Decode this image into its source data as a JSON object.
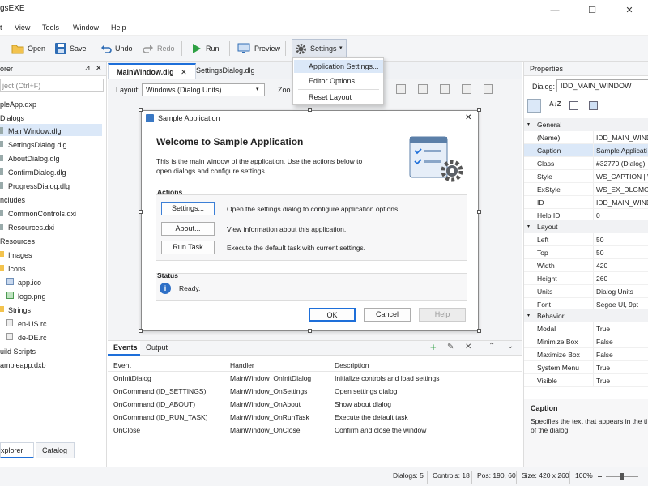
{
  "window": {
    "title": "gsEXE"
  },
  "menu": [
    "t",
    "View",
    "Tools",
    "Window",
    "Help"
  ],
  "toolbar": {
    "open": "Open",
    "save": "Save",
    "undo": "Undo",
    "redo": "Redo",
    "run": "Run",
    "preview": "Preview",
    "settings": "Settings"
  },
  "settings_menu": [
    "Application Settings...",
    "Editor Options...",
    "Reset Layout"
  ],
  "explorer": {
    "title": "orer",
    "search_placeholder": "ject (Ctrl+F)",
    "items": [
      "pleApp.dxp",
      "Dialogs",
      "MainWindow.dlg",
      "SettingsDialog.dlg",
      "AboutDialog.dlg",
      "ConfirmDialog.dlg",
      "ProgressDialog.dlg",
      "ncludes",
      "CommonControls.dxi",
      "Resources.dxi",
      "Resources",
      "Images",
      "Icons",
      "app.ico",
      "logo.png",
      "Strings",
      "en-US.rc",
      "de-DE.rc",
      "uild Scripts",
      "ampleapp.dxb"
    ],
    "bottom_tabs": [
      "xplorer",
      "Catalog"
    ]
  },
  "doc_tabs": [
    "MainWindow.dlg",
    "SettingsDialog.dlg"
  ],
  "designer": {
    "layout_label": "Layout:",
    "layout_value": "Windows (Dialog Units)",
    "zoom_label": "Zoo"
  },
  "dialog": {
    "title": "Sample Application",
    "heading": "Welcome to Sample Application",
    "intro_1": "This is the main window of the application. Use the actions below to",
    "intro_2": "open dialogs and configure settings.",
    "actions_label": "Actions",
    "actions": [
      {
        "button": "Settings...",
        "desc": "Open the settings dialog to configure application options."
      },
      {
        "button": "About...",
        "desc": "View information about this application."
      },
      {
        "button": "Run Task",
        "desc": "Execute the default task with current settings."
      }
    ],
    "status_label": "Status",
    "status_text": "Ready.",
    "ok": "OK",
    "cancel": "Cancel",
    "help": "Help"
  },
  "events": {
    "tabs": [
      "Events",
      "Output"
    ],
    "columns": [
      "Event",
      "Handler",
      "Description"
    ],
    "rows": [
      [
        "OnInitDialog",
        "MainWindow_OnInitDialog",
        "Initialize controls and load settings"
      ],
      [
        "OnCommand (ID_SETTINGS)",
        "MainWindow_OnSettings",
        "Open settings dialog"
      ],
      [
        "OnCommand (ID_ABOUT)",
        "MainWindow_OnAbout",
        "Show about dialog"
      ],
      [
        "OnCommand (ID_RUN_TASK)",
        "MainWindow_OnRunTask",
        "Execute the default task"
      ],
      [
        "OnClose",
        "MainWindow_OnClose",
        "Confirm and close the window"
      ]
    ]
  },
  "properties": {
    "title": "Properties",
    "dialog_label": "Dialog:",
    "dialog_value": "IDD_MAIN_WINDOW",
    "general_label": "General",
    "general": [
      [
        "(Name)",
        "IDD_MAIN_WINDO"
      ],
      [
        "Caption",
        "Sample Applicati"
      ],
      [
        "Class",
        "#32770 (Dialog)"
      ],
      [
        "Style",
        "WS_CAPTION | WS_"
      ],
      [
        "ExStyle",
        "WS_EX_DLGMODA"
      ],
      [
        "ID",
        "IDD_MAIN_WINDO"
      ],
      [
        "Help ID",
        "0"
      ]
    ],
    "layout_label": "Layout",
    "layout": [
      [
        "Left",
        "50"
      ],
      [
        "Top",
        "50"
      ],
      [
        "Width",
        "420"
      ],
      [
        "Height",
        "260"
      ],
      [
        "Units",
        "Dialog Units"
      ],
      [
        "Font",
        "Segoe UI, 9pt"
      ]
    ],
    "behavior_label": "Behavior",
    "behavior": [
      [
        "Modal",
        "True"
      ],
      [
        "Minimize Box",
        "False"
      ],
      [
        "Maximize Box",
        "False"
      ],
      [
        "System Menu",
        "True"
      ],
      [
        "Visible",
        "True"
      ]
    ],
    "desc_title": "Caption",
    "desc_1": "Specifies the text that appears in the ti",
    "desc_2": "of the dialog."
  },
  "status": {
    "dialogs": "Dialogs: 5",
    "controls": "Controls: 18",
    "pos": "Pos: 190, 60",
    "size": "Size: 420 x 260",
    "zoom": "100%"
  }
}
